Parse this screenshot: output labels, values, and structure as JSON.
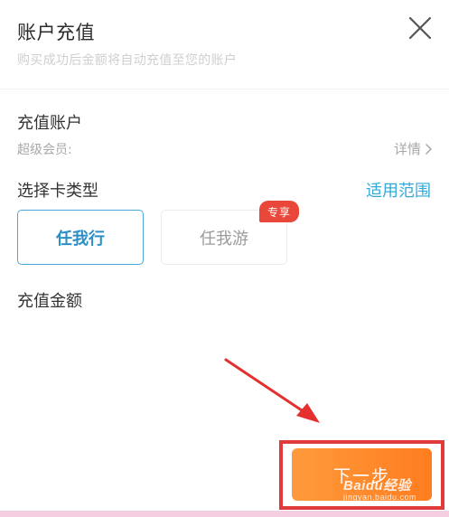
{
  "header": {
    "title": "账户充值",
    "subtitle": "购买成功后金额将自动充值至您的账户"
  },
  "account": {
    "title": "充值账户",
    "member_label": "超级会员:",
    "detail_link": "详情"
  },
  "card_type": {
    "title": "选择卡类型",
    "scope_link": "适用范围",
    "cards": [
      {
        "label": "任我行",
        "selected": true
      },
      {
        "label": "任我游",
        "selected": false,
        "badge": "专享"
      }
    ]
  },
  "amount": {
    "title": "充值金额"
  },
  "footer": {
    "next_label": "下一步"
  },
  "watermark": {
    "logo": "Baidu经验",
    "site": "jingyan.baidu.com"
  },
  "colors": {
    "accent": "#33a9d8",
    "badge": "#e8473a",
    "next_button": "#ff8a2a",
    "highlight": "#e03a3a"
  }
}
